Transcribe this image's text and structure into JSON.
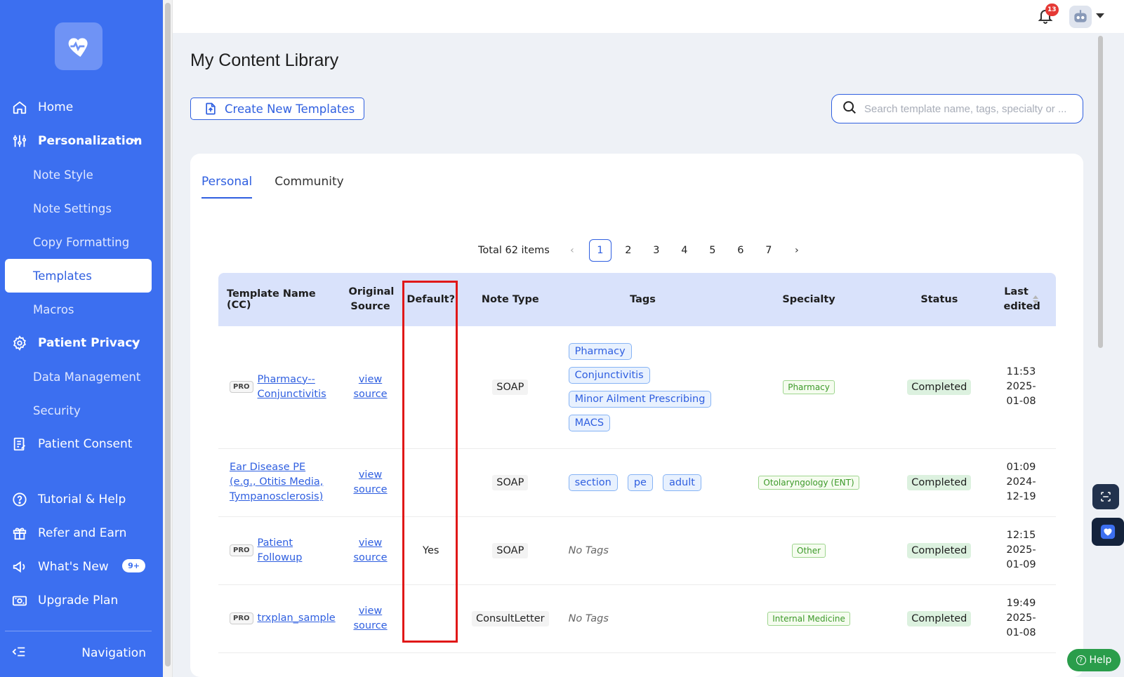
{
  "sidebar": {
    "items": [
      {
        "label": "Home",
        "icon": "home-icon"
      },
      {
        "label": "Personalization",
        "icon": "sliders-icon"
      },
      {
        "label": "Note Style"
      },
      {
        "label": "Note Settings"
      },
      {
        "label": "Copy Formatting"
      },
      {
        "label": "Templates"
      },
      {
        "label": "Macros"
      },
      {
        "label": "Patient Privacy",
        "icon": "shield-gear-icon"
      },
      {
        "label": "Data Management"
      },
      {
        "label": "Security"
      },
      {
        "label": "Patient Consent",
        "icon": "consent-icon"
      },
      {
        "label": "Tutorial & Help",
        "icon": "help-circle-icon"
      },
      {
        "label": "Refer and Earn",
        "icon": "gift-icon"
      },
      {
        "label": "What's New",
        "icon": "megaphone-icon",
        "badge": "9+"
      },
      {
        "label": "Upgrade Plan",
        "icon": "upgrade-icon"
      }
    ],
    "navigation_label": "Navigation"
  },
  "topbar": {
    "notification_count": "13"
  },
  "main": {
    "title": "My Content Library",
    "create_button": "Create New Templates",
    "search_placeholder": "Search template name, tags, specialty or ...",
    "tabs": [
      {
        "label": "Personal",
        "active": true
      },
      {
        "label": "Community",
        "active": false
      }
    ],
    "pagination": {
      "total": "Total 62 items",
      "pages": [
        "1",
        "2",
        "3",
        "4",
        "5",
        "6",
        "7"
      ],
      "current": "1"
    },
    "table": {
      "headers": [
        "Template Name (CC)",
        "Original Source",
        "Default?",
        "Note Type",
        "Tags",
        "Specialty",
        "Status",
        "Last edited"
      ],
      "rows": [
        {
          "pro": "PRO",
          "name": "Pharmacy--Conjunctivitis",
          "source": "view source",
          "default": "",
          "note_type": "SOAP",
          "tags": [
            "Pharmacy",
            "Conjunctivitis",
            "Minor Ailment Prescribing",
            "MACS"
          ],
          "specialty": "Pharmacy",
          "status": "Completed",
          "time": "11:53",
          "date1": "2025-",
          "date2": "01-08"
        },
        {
          "pro": "",
          "name": "Ear Disease PE (e.g., Otitis Media, Tympanosclerosis)",
          "source": "view source",
          "default": "",
          "note_type": "SOAP",
          "tags": [
            "section",
            "pe",
            "adult"
          ],
          "specialty": "Otolaryngology (ENT)",
          "status": "Completed",
          "time": "01:09",
          "date1": "2024-",
          "date2": "12-19"
        },
        {
          "pro": "PRO",
          "name": "Patient Followup",
          "source": "view source",
          "default": "Yes",
          "note_type": "SOAP",
          "tags": [],
          "no_tags": "No Tags",
          "specialty": "Other",
          "status": "Completed",
          "time": "12:15",
          "date1": "2025-",
          "date2": "01-09"
        },
        {
          "pro": "PRO",
          "name": "trxplan_sample",
          "source": "view source",
          "default": "",
          "note_type": "ConsultLetter",
          "tags": [],
          "no_tags": "No Tags",
          "specialty": "Internal Medicine",
          "status": "Completed",
          "time": "19:49",
          "date1": "2025-",
          "date2": "01-08"
        }
      ]
    }
  },
  "help_label": "Help",
  "colors": {
    "sidebar": "#3c6ff0",
    "accent": "#2f5fe0",
    "highlight": "#e01818",
    "status_bg": "#dcf1df",
    "specialty": "#3d9a2a"
  }
}
